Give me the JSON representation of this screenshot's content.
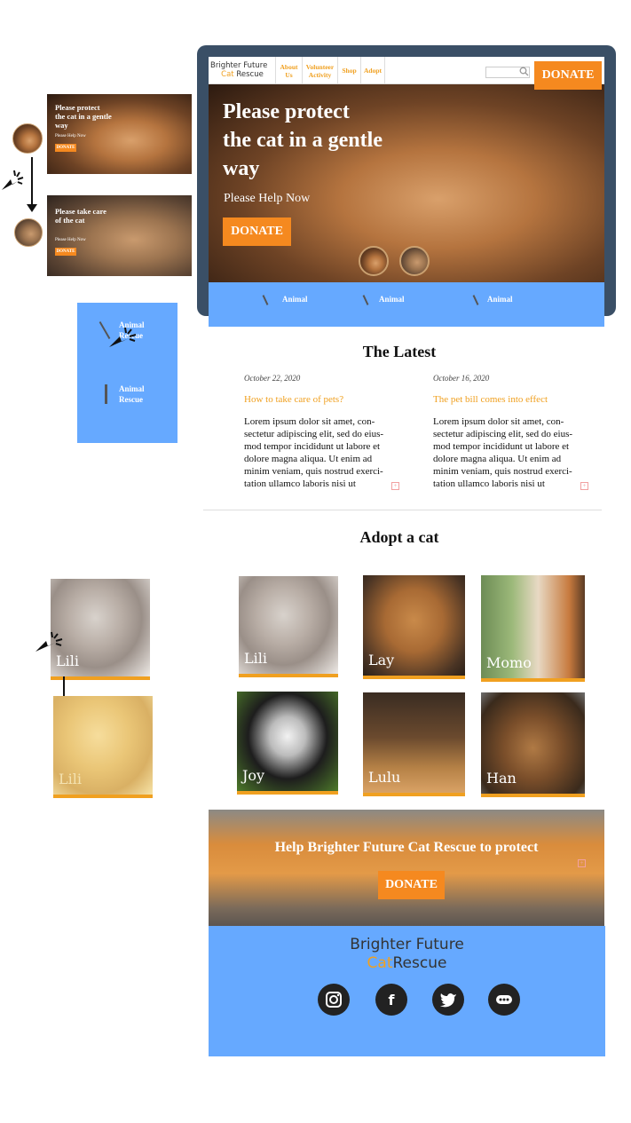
{
  "brand": {
    "line1": "Brighter Future",
    "cat": "Cat",
    "rescue": "Rescue"
  },
  "nav": {
    "items": [
      {
        "label": "About Us"
      },
      {
        "label": "Volunteer Activity"
      },
      {
        "label": "Shop"
      },
      {
        "label": "Adopt"
      }
    ],
    "search_icon": "search-icon",
    "donate_label": "DONATE"
  },
  "hero": {
    "title": "Please protect the cat in a gentle way",
    "subtitle": "Please Help Now",
    "donate_label": "DONATE"
  },
  "strip": {
    "items": [
      "Animal",
      "Animal",
      "Animal"
    ]
  },
  "annotations": {
    "slide1": {
      "title": "Please protect the cat in a gentle way",
      "subtitle": "Please Help Now",
      "donate": "DONATE"
    },
    "slide2": {
      "title": "Please take care of the cat",
      "subtitle": "Please Help Now",
      "donate": "DONATE"
    },
    "blue_box": {
      "label1": "Animal Rescue",
      "label2": "Animal Rescue"
    },
    "card_before": "Lili",
    "card_after": "Lili"
  },
  "latest": {
    "title": "The Latest",
    "posts": [
      {
        "date": "October 22, 2020",
        "title": "How to take care of pets?",
        "body": "Lorem ipsum dolor sit amet, con-sectetur adipiscing elit, sed do eius-mod tempor incididunt ut labore et dolore magna aliqua. Ut enim ad minim veniam, quis nostrud exerci-tation ullamco laboris nisi ut"
      },
      {
        "date": "October 16, 2020",
        "title": "The pet bill comes into effect",
        "body": "Lorem ipsum dolor sit amet, con-sectetur adipiscing elit, sed do eius-mod tempor incididunt ut labore et dolore magna aliqua. Ut enim ad minim veniam, quis nostrud exerci-tation ullamco laboris nisi ut"
      }
    ]
  },
  "adopt": {
    "title": "Adopt a cat",
    "cats": [
      {
        "name": "Lili"
      },
      {
        "name": "Lay"
      },
      {
        "name": "Momo"
      },
      {
        "name": "Joy"
      },
      {
        "name": "Lulu"
      },
      {
        "name": "Han"
      }
    ]
  },
  "banner": {
    "text": "Help Brighter Future Cat Rescue to protect",
    "donate_label": "DONATE"
  },
  "footer": {
    "social": [
      "instagram-icon",
      "facebook-icon",
      "twitter-icon",
      "more-icon"
    ]
  },
  "colors": {
    "accent": "#f5891f",
    "gold": "#f0a020",
    "blue": "#66a9ff",
    "device": "#3a4f66"
  }
}
